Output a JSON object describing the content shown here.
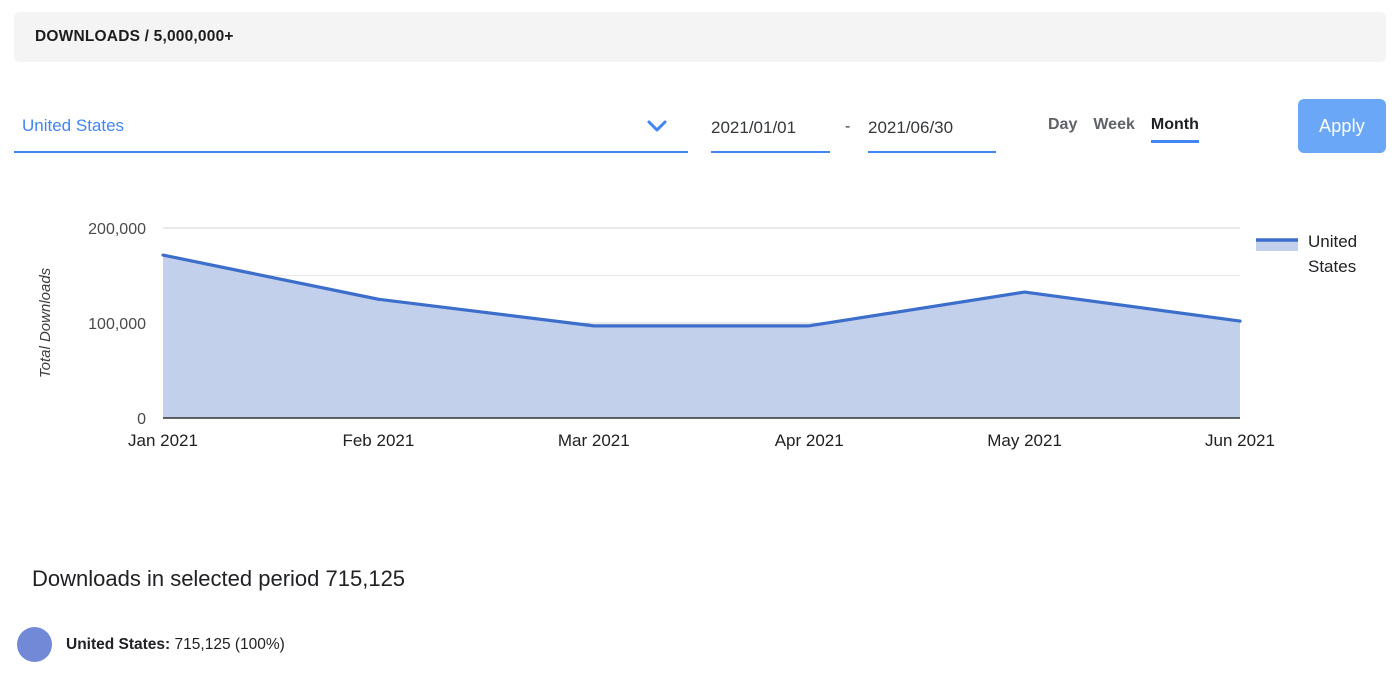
{
  "header": {
    "title": "DOWNLOADS / 5,000,000+"
  },
  "controls": {
    "country_selector": {
      "value": "United States",
      "icon": "chevron-down-icon"
    },
    "date_from": {
      "value": "2021/01/01",
      "placeholder": "YYYY/MM/DD"
    },
    "date_separator": "-",
    "date_to": {
      "value": "2021/06/30",
      "placeholder": "YYYY/MM/DD"
    },
    "granularity": [
      {
        "label": "Day",
        "active": false
      },
      {
        "label": "Week",
        "active": false
      },
      {
        "label": "Month",
        "active": true
      }
    ],
    "apply_label": "Apply"
  },
  "colors": {
    "accent_blue": "#4285f4",
    "apply_button": "#6aa8f7",
    "series_line": "#3c6ecb",
    "series_fill": "#c3d0ec",
    "legend_dot": "#7189d6",
    "header_bg": "#f4f4f4"
  },
  "chart_data": {
    "type": "area",
    "title": "",
    "xlabel": "",
    "ylabel": "Total Downloads",
    "categories": [
      "Jan 2021",
      "Feb 2021",
      "Mar 2021",
      "Apr 2021",
      "May 2021",
      "Jun 2021"
    ],
    "series": [
      {
        "name": "United States",
        "values": [
          171500,
          125000,
          97000,
          97000,
          132600,
          102000
        ]
      }
    ],
    "ylim": [
      0,
      200000
    ],
    "ytick_labels": [
      "0",
      "100,000",
      "200,000"
    ],
    "ytick_values": [
      0,
      100000,
      200000
    ],
    "minor_gridlines": [
      50000,
      150000
    ],
    "grid": true,
    "legend": {
      "position": "right",
      "entries": [
        "United States"
      ]
    }
  },
  "summary": {
    "title": "Downloads in selected period 715,125",
    "breakdown": [
      {
        "country": "United States:",
        "detail": "715,125 (100%)"
      }
    ]
  }
}
